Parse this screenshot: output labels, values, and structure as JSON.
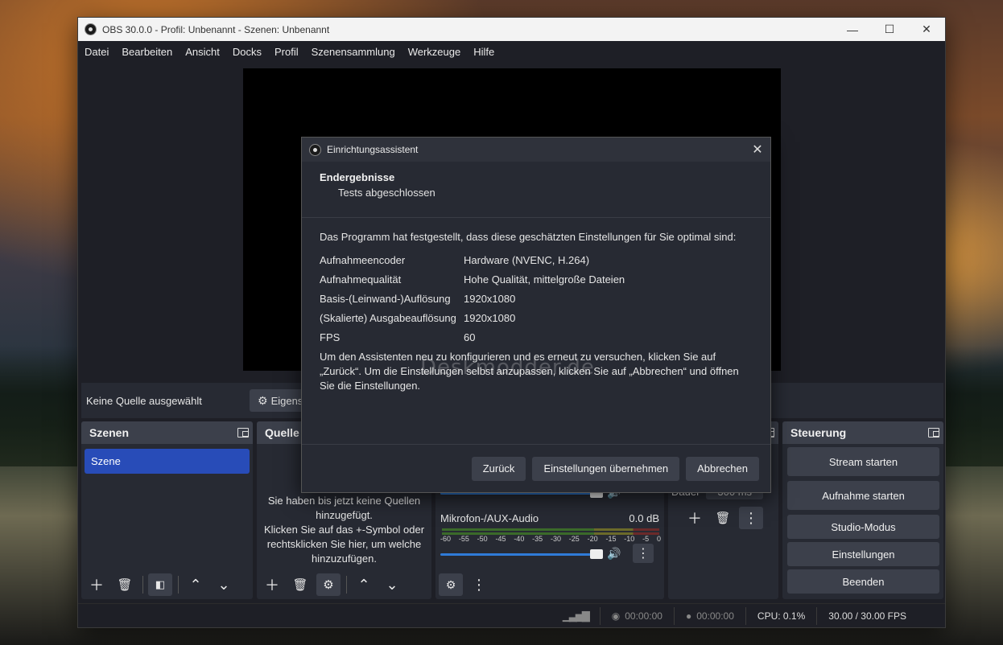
{
  "window": {
    "title": "OBS 30.0.0 - Profil: Unbenannt - Szenen: Unbenannt",
    "minimize": "—",
    "maximize": "☐",
    "close": "✕"
  },
  "menu": [
    "Datei",
    "Bearbeiten",
    "Ansicht",
    "Docks",
    "Profil",
    "Szenensammlung",
    "Werkzeuge",
    "Hilfe"
  ],
  "sourcebar": {
    "no_source": "Keine Quelle ausgewählt",
    "properties": "Eigens"
  },
  "scenes": {
    "title": "Szenen",
    "items": [
      "Szene"
    ]
  },
  "sources": {
    "title": "Quelle",
    "empty_text": "Sie haben bis jetzt keine Quellen hinzugefügt.\nKlicken Sie auf das +-Symbol oder rechtsklicken Sie hier, um welche hinzuzufügen."
  },
  "audio": {
    "channel": "Mikrofon-/AUX-Audio",
    "db": "0.0 dB",
    "ticks": [
      "-60",
      "-55",
      "-50",
      "-45",
      "-40",
      "-35",
      "-30",
      "-25",
      "-20",
      "-15",
      "-10",
      "-5",
      "0"
    ]
  },
  "transitions": {
    "duration_label": "Dauer",
    "duration_value": "300 ms"
  },
  "controls": {
    "title": "Steuerung",
    "buttons": [
      "Stream starten",
      "Aufnahme starten",
      "Studio-Modus",
      "Einstellungen",
      "Beenden"
    ]
  },
  "statusbar": {
    "stream_time": "00:00:00",
    "rec_time": "00:00:00",
    "cpu": "CPU: 0.1%",
    "fps": "30.00 / 30.00 FPS"
  },
  "dialog": {
    "title": "Einrichtungsassistent",
    "heading": "Endergebnisse",
    "subheading": "Tests abgeschlossen",
    "intro": "Das Programm hat festgestellt, dass diese geschätzten Einstellungen für Sie optimal sind:",
    "settings": [
      {
        "key": "Aufnahmeencoder",
        "value": "Hardware (NVENC, H.264)"
      },
      {
        "key": "Aufnahmequalität",
        "value": "Hohe Qualität, mittelgroße Dateien"
      },
      {
        "key": "Basis-(Leinwand-)Auflösung",
        "value": "1920x1080"
      },
      {
        "key": "(Skalierte) Ausgabeauflösung",
        "value": "1920x1080"
      },
      {
        "key": "FPS",
        "value": "60"
      }
    ],
    "note": "Um den Assistenten neu zu konfigurieren und es erneut zu versuchen, klicken Sie auf „Zurück“. Um die Einstellungen selbst anzupassen, klicken Sie auf „Abbrechen“ und öffnen Sie die Einstellungen.",
    "back": "Zurück",
    "apply": "Einstellungen übernehmen",
    "cancel": "Abbrechen"
  },
  "watermark": "Deskmodder.de"
}
